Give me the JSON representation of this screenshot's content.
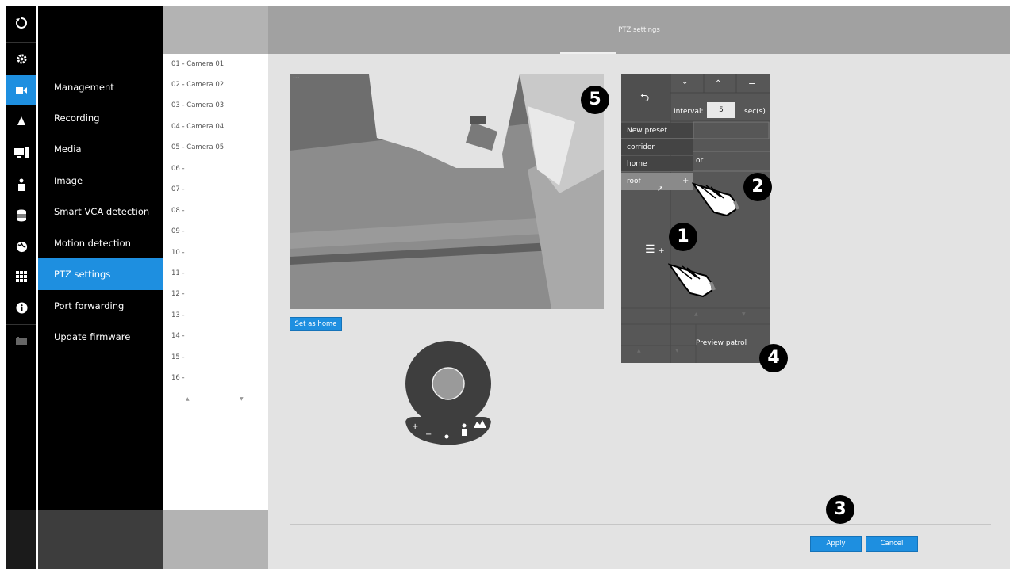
{
  "header": {
    "title": "PTZ settings"
  },
  "iconbar": {
    "icons": [
      "logout-icon",
      "gear-icon",
      "camera-icon",
      "bell-icon",
      "monitor-icon",
      "person-icon",
      "database-icon",
      "globe-icon",
      "grid-icon",
      "info-icon",
      "keyboard-icon"
    ],
    "active": "camera-icon"
  },
  "nav": {
    "items": [
      {
        "label": "Management"
      },
      {
        "label": "Recording"
      },
      {
        "label": "Media"
      },
      {
        "label": "Image"
      },
      {
        "label": "Smart VCA detection"
      },
      {
        "label": "Motion detection"
      },
      {
        "label": "PTZ settings",
        "active": true
      },
      {
        "label": "Port forwarding"
      },
      {
        "label": "Update firmware"
      }
    ]
  },
  "cameras": {
    "items": [
      "01 - Camera 01",
      "02 - Camera 02",
      "03 - Camera 03",
      "04 - Camera 04",
      "05 - Camera 05",
      "06 -",
      "07 -",
      "08 -",
      "09 -",
      "10 -",
      "11 -",
      "12 -",
      "13 -",
      "14 -",
      "15 -",
      "16 -"
    ],
    "selected_index": 0
  },
  "video": {
    "set_home_label": "Set as home"
  },
  "patrol_panel": {
    "interval_label": "Interval:",
    "interval_value": "5",
    "interval_unit": "sec(s)",
    "presets": [
      "New preset",
      "corridor",
      "home",
      "roof"
    ],
    "partial_text": "or",
    "preview_label": "Preview patrol"
  },
  "footer": {
    "apply_label": "Apply",
    "cancel_label": "Cancel"
  },
  "callouts": [
    "1",
    "2",
    "3",
    "4",
    "5"
  ],
  "colors": {
    "accent": "#1e8fe0",
    "sidebar_bg": "#000000",
    "panel_bg": "#555555",
    "content_bg": "#e3e3e3"
  }
}
